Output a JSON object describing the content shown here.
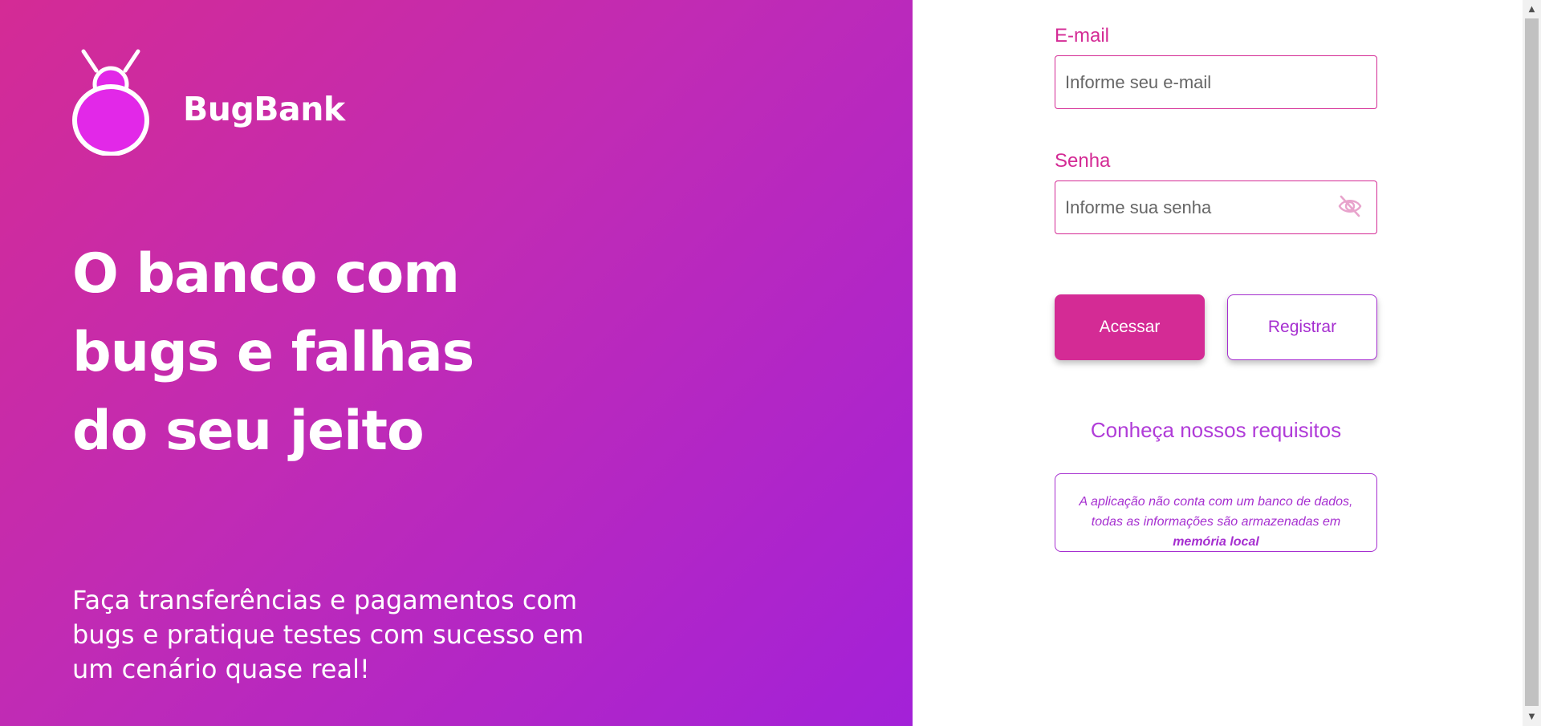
{
  "brand": {
    "name": "BugBank"
  },
  "hero": {
    "headline_lines": [
      "O banco com",
      "bugs e falhas",
      "do seu jeito"
    ],
    "subtext_lines": [
      "Faça transferências e pagamentos com",
      "bugs e pratique testes com sucesso em",
      "um cenário quase real!"
    ]
  },
  "login": {
    "email_label": "E-mail",
    "email_placeholder": "Informe seu e-mail",
    "password_label": "Senha",
    "password_placeholder": "Informe sua senha",
    "access_button": "Acessar",
    "register_button": "Registrar",
    "requirements_link": "Conheça nossos requisitos",
    "notice_text": "A aplicação não conta com um banco de dados, todas as informações são armazenadas em",
    "notice_emphasis": "memória local"
  },
  "colors": {
    "primary": "#d42b95",
    "secondary": "#a62fd0",
    "gradient_start": "#d42b95",
    "gradient_end": "#a321d8"
  },
  "icons": {
    "logo": "bug-logo-icon",
    "password_toggle": "eye-slash-icon",
    "scroll_up": "arrow-up-icon",
    "scroll_down": "arrow-down-icon"
  }
}
